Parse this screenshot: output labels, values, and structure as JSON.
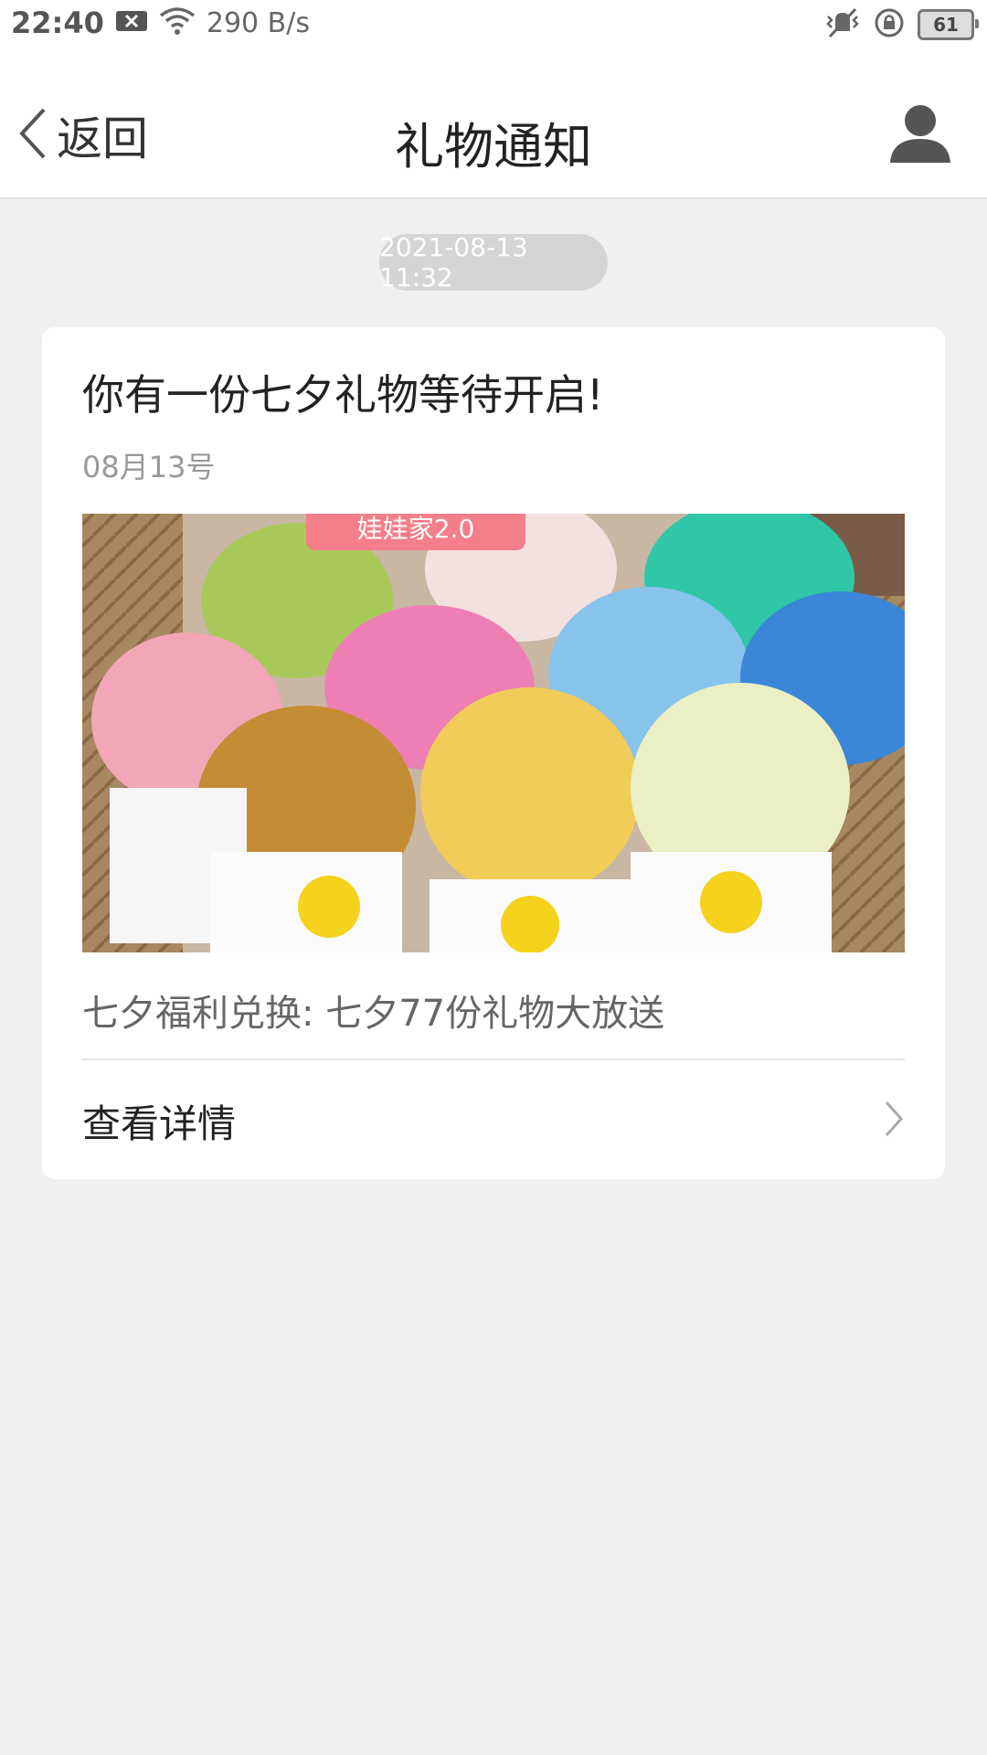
{
  "status_bar": {
    "time": "22:40",
    "network_speed": "290 B/s",
    "battery": "61",
    "icons": [
      "notification-x-icon",
      "wifi-icon",
      "vibrate-icon",
      "rotation-lock-icon",
      "battery-icon"
    ]
  },
  "nav": {
    "back_label": "返回",
    "title": "礼物通知",
    "back_icon": "chevron-left-icon",
    "profile_icon": "user-icon"
  },
  "message": {
    "timestamp": "2021-08-13 11:32",
    "title": "你有一份七夕礼物等待开启!",
    "date": "08月13号",
    "image_banner_text": "娃娃家2.0",
    "description": "七夕福利兑换: 七夕77份礼物大放送",
    "detail_label": "查看详情",
    "detail_icon": "chevron-right-icon"
  },
  "colors": {
    "background": "#f0f0f0",
    "card": "#ffffff",
    "pill": "#d5d5d5"
  }
}
